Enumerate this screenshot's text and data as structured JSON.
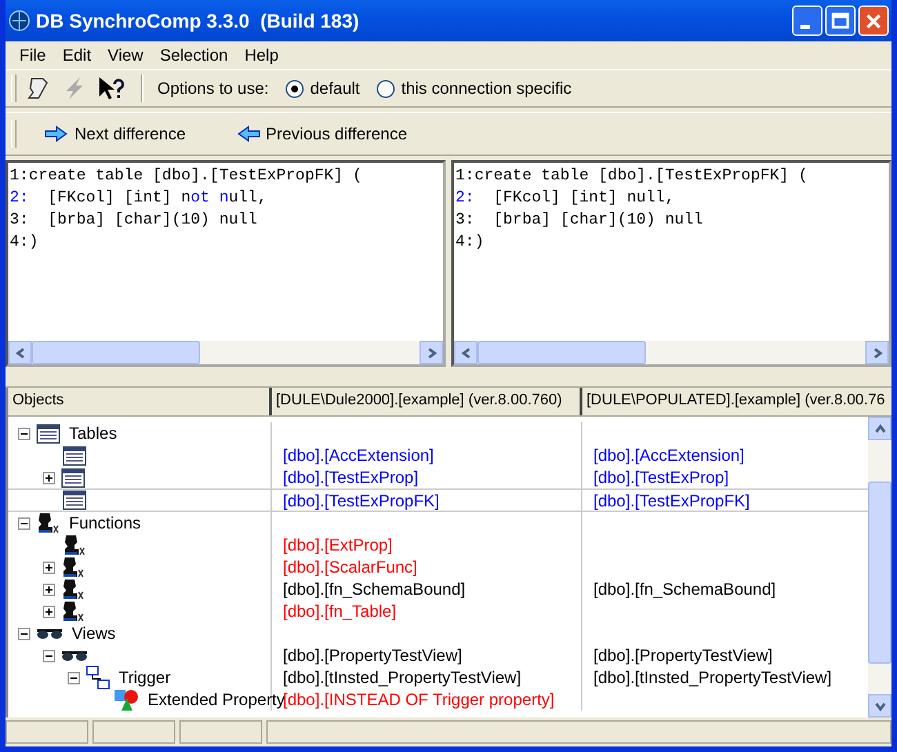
{
  "window": {
    "title": "DB SynchroComp 3.3.0  (Build 183)"
  },
  "menu": [
    "File",
    "Edit",
    "View",
    "Selection",
    "Help"
  ],
  "options": {
    "label": "Options to use:",
    "choices": [
      {
        "label": "default",
        "selected": true
      },
      {
        "label": "this connection specific",
        "selected": false
      }
    ]
  },
  "nav": [
    {
      "kind": "next",
      "label": "Next difference"
    },
    {
      "kind": "previous",
      "label": "Previous difference"
    }
  ],
  "panes": [
    {
      "lines": [
        {
          "num": "1:",
          "changed": false,
          "parts": [
            {
              "text": "create table [dbo].[TestExPropFK] (",
              "changed": false
            }
          ]
        },
        {
          "num": "2:",
          "changed": true,
          "parts": [
            {
              "text": "  [FKcol] [int] n",
              "changed": false
            },
            {
              "text": "ot n",
              "changed": true
            },
            {
              "text": "ull,",
              "changed": false
            }
          ]
        },
        {
          "num": "3:",
          "changed": false,
          "parts": [
            {
              "text": "  [brba] [char](10) null",
              "changed": false
            }
          ]
        },
        {
          "num": "4:",
          "changed": false,
          "parts": [
            {
              "text": ")",
              "changed": false
            }
          ]
        }
      ]
    },
    {
      "lines": [
        {
          "num": "1:",
          "changed": false,
          "parts": [
            {
              "text": "create table [dbo].[TestExPropFK] (",
              "changed": false
            }
          ]
        },
        {
          "num": "2:",
          "changed": true,
          "parts": [
            {
              "text": "  [FKcol] [int] null,",
              "changed": false
            }
          ]
        },
        {
          "num": "3:",
          "changed": false,
          "parts": [
            {
              "text": "  [brba] [char](10) null",
              "changed": false
            }
          ]
        },
        {
          "num": "4:",
          "changed": false,
          "parts": [
            {
              "text": ")",
              "changed": false
            }
          ]
        }
      ]
    }
  ],
  "grid": {
    "columns": [
      "Objects",
      "[DULE\\Dule2000].[example] (ver.8.00.760)",
      "[DULE\\POPULATED].[example] (ver.8.00.76"
    ],
    "tree": [
      {
        "kind": "table",
        "label": "Tables",
        "expanded": true,
        "selected": false,
        "children": [
          {
            "kind": "table",
            "selected": false,
            "left": {
              "text": "[dbo].[AccExtension]",
              "color": "#0000ff"
            },
            "right": {
              "text": "[dbo].[AccExtension]",
              "color": "#0000ff"
            }
          },
          {
            "kind": "table",
            "expanded": false,
            "selected": false,
            "left": {
              "text": "[dbo].[TestExProp]",
              "color": "#0000ff"
            },
            "right": {
              "text": "[dbo].[TestExProp]",
              "color": "#0000ff"
            }
          },
          {
            "kind": "table",
            "selected": true,
            "left": {
              "text": "[dbo].[TestExPropFK]",
              "color": "#0000ff"
            },
            "right": {
              "text": "[dbo].[TestExPropFK]",
              "color": "#0000ff"
            }
          }
        ]
      },
      {
        "kind": "function",
        "label": "Functions",
        "expanded": true,
        "selected": false,
        "children": [
          {
            "kind": "function",
            "selected": false,
            "left": {
              "text": "[dbo].[ExtProp]",
              "color": "#ff0000"
            }
          },
          {
            "kind": "function",
            "expanded": false,
            "selected": false,
            "left": {
              "text": "[dbo].[ScalarFunc]",
              "color": "#ff0000"
            }
          },
          {
            "kind": "function",
            "expanded": false,
            "selected": false,
            "left": {
              "text": "[dbo].[fn_SchemaBound]",
              "color": "#000000"
            },
            "right": {
              "text": "[dbo].[fn_SchemaBound]",
              "color": "#000000"
            }
          },
          {
            "kind": "function",
            "expanded": false,
            "selected": false,
            "left": {
              "text": "[dbo].[fn_Table]",
              "color": "#ff0000"
            }
          }
        ]
      },
      {
        "kind": "view",
        "label": "Views",
        "expanded": true,
        "selected": false,
        "children": [
          {
            "kind": "view",
            "expanded": true,
            "selected": false,
            "left": {
              "text": "[dbo].[PropertyTestView]",
              "color": "#000000"
            },
            "right": {
              "text": "[dbo].[PropertyTestView]",
              "color": "#000000"
            },
            "children": [
              {
                "kind": "trigger",
                "label": "Trigger",
                "expanded": true,
                "selected": false,
                "left": {
                  "text": "[dbo].[tInsted_PropertyTestView]",
                  "color": "#000000"
                },
                "right": {
                  "text": "[dbo].[tInsted_PropertyTestView]",
                  "color": "#000000"
                },
                "children": [
                  {
                    "kind": "property",
                    "label": "Extended Property",
                    "selected": false,
                    "left": {
                      "text": "[dbo].[INSTEAD OF Trigger property]",
                      "color": "#ff0000"
                    }
                  }
                ]
              }
            ]
          }
        ]
      }
    ]
  }
}
